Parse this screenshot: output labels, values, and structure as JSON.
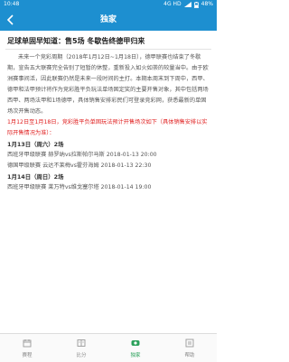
{
  "status_bar": {
    "time": "10:48",
    "network": "4G HD",
    "battery": "48%"
  },
  "nav": {
    "title": "独家"
  },
  "article": {
    "title": "足球单固早知道：售5场 冬歇告终德甲归来",
    "paragraph1": "未来一个竞彩周期（2018年1月12日~1月18日），德甲联赛也结束了冬歇期，宣告五大联赛完全告别了短暂的休整，重新投入如火如荼的较量当中。由于欧洲赛事间活，因此联赛仍然是未来一段时间的主打。本期本周末到下周中，西甲、德甲和法甲预计将作为竞彩胜平负玩法单场固定奖的主要开售对象，其中包括两场西甲、两场法甲和1场德甲，具体销售安排彩民们可登录竞彩网，获悉最新的单固场次开售动态。",
    "notice_line1": "1月12日至1月18日，竞彩胜平负单固玩法预计开售场次如下（具体销售安排以实际开售情况为准）：",
    "days": [
      {
        "label": "1月13日（周六）2场",
        "matches": [
          "西班牙甲级联赛 赫罗纳vs拉斯帕尔马斯 2018-01-13 20:00",
          "德国甲级联赛 云达不莱梅vs霍芬海姆 2018-01-13 22:30"
        ]
      },
      {
        "label": "1月14日（周日）2场",
        "matches": [
          "西班牙甲级联赛 莱万特vs维戈塞尔塔 2018-01-14 19:00"
        ]
      }
    ]
  },
  "tabs": [
    {
      "label": "赛程",
      "icon": "calendar-icon",
      "active": false
    },
    {
      "label": "比分",
      "icon": "scoreboard-icon",
      "active": false
    },
    {
      "label": "独家",
      "icon": "exclusive-icon",
      "active": true
    },
    {
      "label": "帮助",
      "icon": "help-icon",
      "active": false
    }
  ],
  "colors": {
    "brand_blue": "#1d8fd0",
    "highlight_red": "#e02020",
    "active_green": "#2aa05a"
  }
}
